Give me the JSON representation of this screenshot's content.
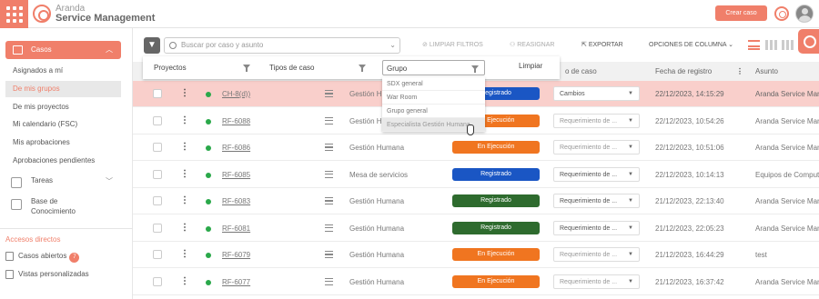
{
  "header": {
    "brand_line1": "Aranda",
    "brand_line2": "Service Management",
    "create_label": "Crear caso"
  },
  "sidebar": {
    "section_label": "Casos",
    "items": [
      {
        "label": "Asignados a mí",
        "active": false
      },
      {
        "label": "De mis grupos",
        "active": true
      },
      {
        "label": "De mis proyectos",
        "active": false
      },
      {
        "label": "Mi calendario (FSC)",
        "active": false
      },
      {
        "label": "Mis aprobaciones",
        "active": false
      },
      {
        "label": "Aprobaciones pendientes",
        "active": false
      }
    ],
    "tareas_label": "Tareas",
    "kb_label_1": "Base de",
    "kb_label_2": "Conocimiento",
    "accesos_label": "Accesos directos",
    "casos_abiertos_label": "Casos abiertos",
    "casos_abiertos_count": "7",
    "vistas_label": "Vistas personalizadas"
  },
  "toolbar": {
    "search_placeholder": "Buscar por caso y asunto",
    "clear_filters": "LIMPIAR FILTROS",
    "reassign": "REASIGNAR",
    "export": "EXPORTAR",
    "column_options": "OPCIONES DE COLUMNA"
  },
  "table": {
    "headers": {
      "state": "o de caso",
      "registered": "Fecha de registro",
      "subject": "Asunto"
    },
    "rows": [
      {
        "id": "CH-8(d))",
        "group": "Gestión Humana",
        "status": "Registrado",
        "status_color": "#1a56c4",
        "action": "Cambios",
        "date": "22/12/2023, 14:15:29",
        "subject": "Arandа Service Management"
      },
      {
        "id": "RF-6088",
        "group": "Gestión Humana",
        "status": "En Ejecución",
        "status_color": "#f07520",
        "action": "Requerimiento de ...",
        "date": "22/12/2023, 10:54:26",
        "subject": "Arandа Service Management"
      },
      {
        "id": "RF-6086",
        "group": "Gestión Humana",
        "status": "En Ejecución",
        "status_color": "#f07520",
        "action": "Requerimiento de ...",
        "date": "22/12/2023, 10:51:06",
        "subject": "Arandа Service Management"
      },
      {
        "id": "RF-6085",
        "group": "Mesa de servicios",
        "status": "Registrado",
        "status_color": "#1a56c4",
        "action": "Requerimiento de ...",
        "date": "22/12/2023, 10:14:13",
        "subject": "Equipos de Computo"
      },
      {
        "id": "RF-6083",
        "group": "Gestión Humana",
        "status": "Registrado",
        "status_color": "#2e6b2e",
        "action": "Requerimiento de ...",
        "date": "21/12/2023, 22:13:40",
        "subject": "Arandа Service Management"
      },
      {
        "id": "RF-6081",
        "group": "Gestión Humana",
        "status": "Registrado",
        "status_color": "#2e6b2e",
        "action": "Requerimiento de ...",
        "date": "21/12/2023, 22:05:23",
        "subject": "Arandа Service Management"
      },
      {
        "id": "RF-6079",
        "group": "Gestión Humana",
        "status": "En Ejecución",
        "status_color": "#f07520",
        "action": "Requerimiento de ...",
        "date": "21/12/2023, 16:44:29",
        "subject": "test"
      },
      {
        "id": "RF-6077",
        "group": "Gestión Humana",
        "status": "En Ejecución",
        "status_color": "#f07520",
        "action": "Requerimiento de ...",
        "date": "21/12/2023, 16:37:42",
        "subject": "Arandа Service Management"
      }
    ]
  },
  "filters": {
    "proyectos": "Proyectos",
    "tipos": "Tipos de caso",
    "grupo": "Grupo",
    "clear": "Limpiar",
    "options": [
      "SDX general",
      "War Room",
      "Grupo general",
      "Especialista Gestión Humana"
    ]
  },
  "colors": {
    "accent": "#f07f6a",
    "highlight_row": "#f9cfcb"
  }
}
